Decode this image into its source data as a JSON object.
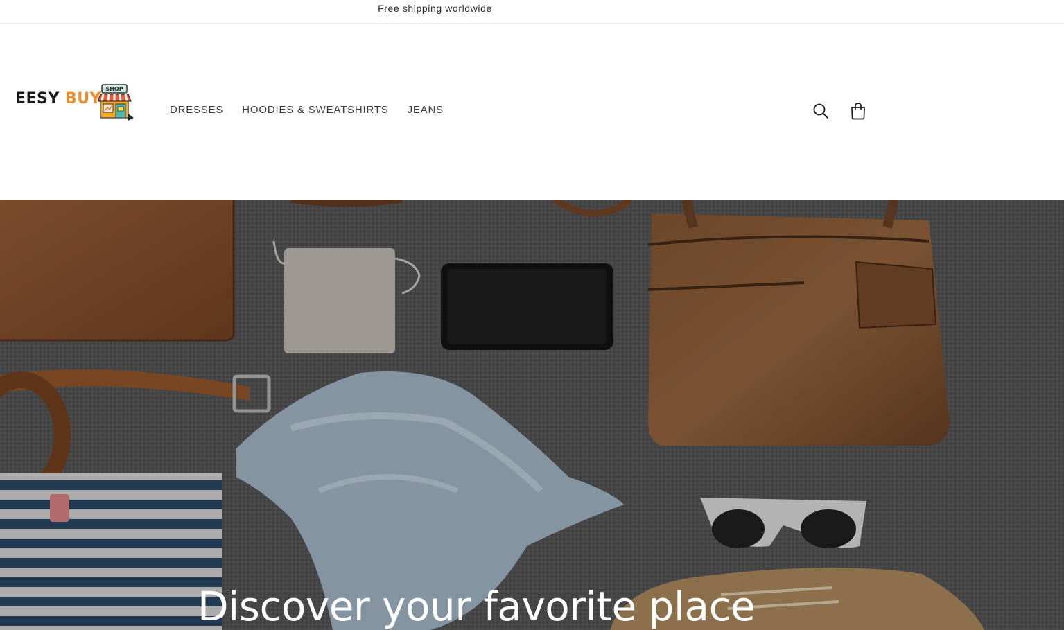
{
  "announcement": {
    "text": "Free shipping worldwide"
  },
  "logo": {
    "word1": "EESY",
    "word2": "BUY",
    "sign": "SHOP"
  },
  "nav": {
    "items": [
      {
        "label": "DRESSES"
      },
      {
        "label": "HOODIES & SWEATSHIRTS"
      },
      {
        "label": "JEANS"
      }
    ]
  },
  "header_icons": {
    "search": "search-icon",
    "cart": "cart-icon"
  },
  "hero": {
    "heading": "Discover your favorite place"
  },
  "colors": {
    "accent": "#f28c28",
    "text": "#121212",
    "nav_text": "#3b3b3b"
  }
}
